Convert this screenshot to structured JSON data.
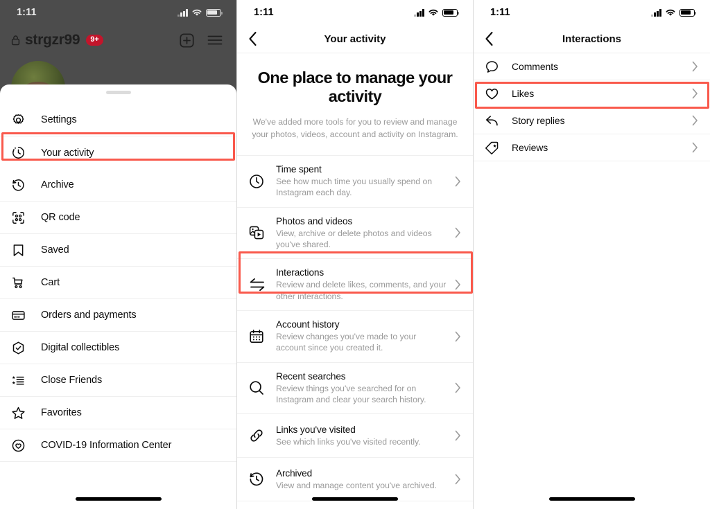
{
  "highlight_color": "#f9594c",
  "panels": {
    "left": {
      "status": {
        "time": "1:11"
      },
      "profile": {
        "username": "strgzr99",
        "badge": "9+",
        "lock_icon": "lock-icon",
        "add_icon": "add-post-icon",
        "menu_icon": "hamburger-menu-icon"
      },
      "sheet_items": [
        {
          "label": "Settings",
          "icon": "gear-icon",
          "highlighted": false
        },
        {
          "label": "Your activity",
          "icon": "activity-clock-icon",
          "highlighted": true
        },
        {
          "label": "Archive",
          "icon": "archive-clock-icon",
          "highlighted": false
        },
        {
          "label": "QR code",
          "icon": "qr-code-icon",
          "highlighted": false
        },
        {
          "label": "Saved",
          "icon": "bookmark-icon",
          "highlighted": false
        },
        {
          "label": "Cart",
          "icon": "shopping-cart-icon",
          "highlighted": false
        },
        {
          "label": "Orders and payments",
          "icon": "credit-card-icon",
          "highlighted": false
        },
        {
          "label": "Digital collectibles",
          "icon": "hexagon-check-icon",
          "highlighted": false
        },
        {
          "label": "Close Friends",
          "icon": "close-friends-list-icon",
          "highlighted": false
        },
        {
          "label": "Favorites",
          "icon": "star-icon",
          "highlighted": false
        },
        {
          "label": "COVID-19 Information Center",
          "icon": "covid-info-icon",
          "highlighted": false
        }
      ]
    },
    "mid": {
      "status": {
        "time": "1:11"
      },
      "nav": {
        "title": "Your activity",
        "back_icon": "chevron-left-icon"
      },
      "hero": {
        "title": "One place to manage your activity",
        "subtitle": "We've added more tools for you to review and manage your photos, videos, account and activity on Instagram."
      },
      "rows": [
        {
          "title": "Time spent",
          "desc": "See how much time you usually spend on Instagram each day.",
          "icon": "clock-icon",
          "highlighted": false
        },
        {
          "title": "Photos and videos",
          "desc": "View, archive or delete photos and videos you've shared.",
          "icon": "photos-videos-icon",
          "highlighted": false
        },
        {
          "title": "Interactions",
          "desc": "Review and delete likes, comments, and your other interactions.",
          "icon": "interactions-arrows-icon",
          "highlighted": true
        },
        {
          "title": "Account history",
          "desc": "Review changes you've made to your account since you created it.",
          "icon": "calendar-icon",
          "highlighted": false
        },
        {
          "title": "Recent searches",
          "desc": "Review things you've searched for on Instagram and clear your search history.",
          "icon": "search-icon",
          "highlighted": false
        },
        {
          "title": "Links you've visited",
          "desc": "See which links you've visited recently.",
          "icon": "link-icon",
          "highlighted": false
        },
        {
          "title": "Archived",
          "desc": "View and manage content you've archived.",
          "icon": "archive-clock-icon",
          "highlighted": false
        }
      ]
    },
    "right": {
      "status": {
        "time": "1:11"
      },
      "nav": {
        "title": "Interactions",
        "back_icon": "chevron-left-icon"
      },
      "rows": [
        {
          "label": "Comments",
          "icon": "comment-bubble-icon",
          "highlighted": false
        },
        {
          "label": "Likes",
          "icon": "heart-icon",
          "highlighted": true
        },
        {
          "label": "Story replies",
          "icon": "reply-arrow-icon",
          "highlighted": false
        },
        {
          "label": "Reviews",
          "icon": "tag-star-icon",
          "highlighted": false
        }
      ]
    }
  }
}
